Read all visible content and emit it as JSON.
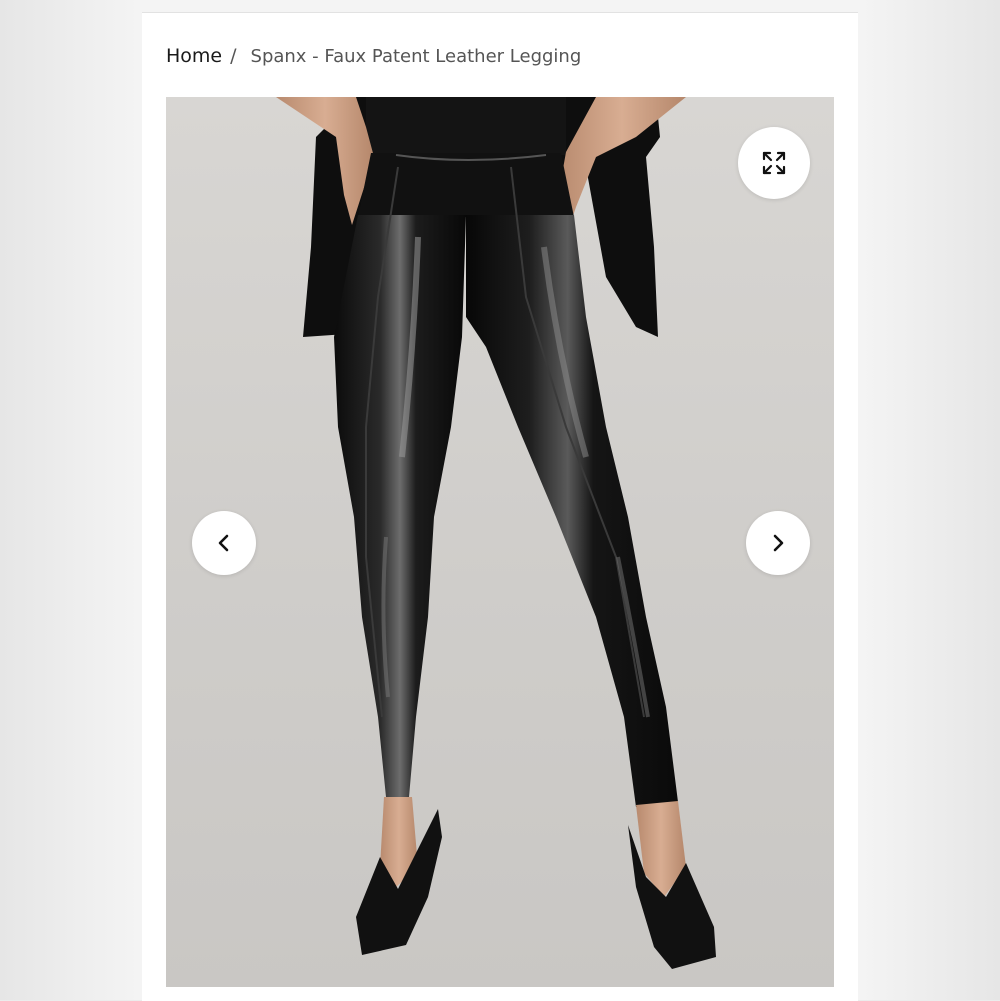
{
  "breadcrumb": {
    "home_label": "Home",
    "separator": "/",
    "current_label": "Spanx - Faux Patent Leather Legging"
  },
  "gallery": {
    "image_alt": "Spanx - Faux Patent Leather Legging",
    "expand_icon": "expand-arrows-icon",
    "prev_icon": "chevron-left-icon",
    "next_icon": "chevron-right-icon"
  },
  "colors": {
    "background": "#f4f4f4",
    "card": "#ffffff",
    "text": "#222222",
    "photo_background": "#d4d2cf"
  }
}
